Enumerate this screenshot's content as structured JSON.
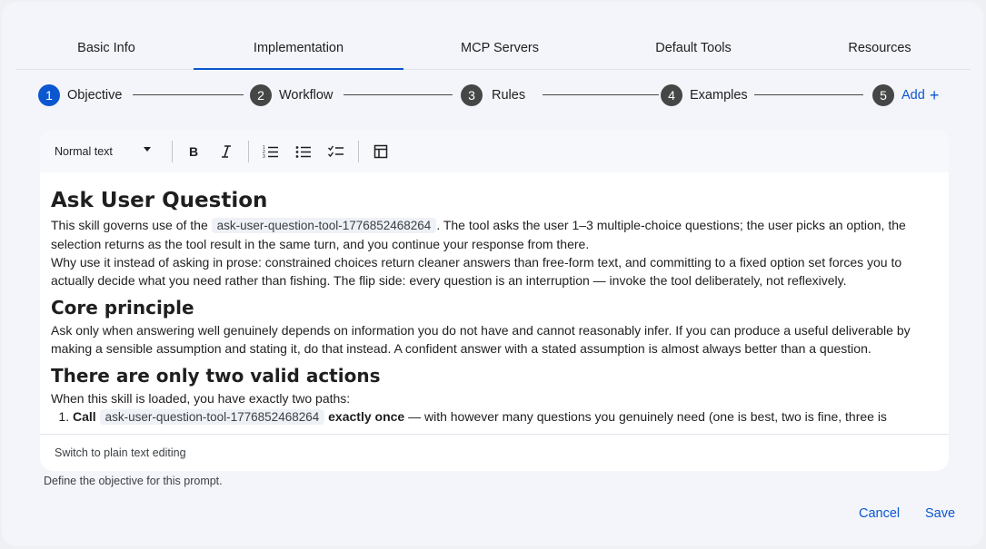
{
  "tabs": [
    {
      "label": "Basic Info"
    },
    {
      "label": "Implementation"
    },
    {
      "label": "MCP Servers"
    },
    {
      "label": "Default Tools"
    },
    {
      "label": "Resources"
    }
  ],
  "active_tab": "Implementation",
  "steps": [
    {
      "number": "1",
      "label": "Objective"
    },
    {
      "number": "2",
      "label": "Workflow"
    },
    {
      "number": "3",
      "label": "Rules"
    },
    {
      "number": "4",
      "label": "Examples"
    },
    {
      "number": "5",
      "label": "Add",
      "suffix": "+"
    }
  ],
  "toolbar": {
    "style_select": "Normal text",
    "icons": [
      "bold-icon",
      "italic-icon",
      "numbered-list-icon",
      "bulleted-list-icon",
      "checklist-icon",
      "table-icon"
    ]
  },
  "document": {
    "h1": "Ask User Question",
    "p1_before": "This skill governs use of the ",
    "p1_code": "ask-user-question-tool-1776852468264",
    "p1_after": ". The tool asks the user 1–3 multiple-choice questions; the user picks an option, the selection returns as the tool result in the same turn, and you continue your response from there.",
    "p2": "Why use it instead of asking in prose: constrained choices return cleaner answers than free-form text, and committing to a fixed option set forces you to actually decide what you need rather than fishing. The flip side: every question is an interruption — invoke the tool deliberately, not reflexively.",
    "h2_core": "Core principle",
    "p3": "Ask only when answering well genuinely depends on information you do not have and cannot reasonably infer. If you can produce a useful deliverable by making a sensible assumption and stating it, do that instead. A confident answer with a stated assumption is almost always better than a question.",
    "h2_actions": "There are only two valid actions",
    "p4": "When this skill is loaded, you have exactly two paths:",
    "li1_call": "Call",
    "li1_code": "ask-user-question-tool-1776852468264",
    "li1_bold": "exactly once",
    "li1_rest": " — with however many questions you genuinely need (one is best, two is fine, three is"
  },
  "editor_footer": "Switch to plain text editing",
  "helper_text": "Define the objective for this prompt.",
  "actions": {
    "cancel": "Cancel",
    "save": "Save"
  },
  "colors": {
    "accent": "#0b57d0",
    "step_inactive": "#444746",
    "dialog_bg": "#f3f5fa"
  }
}
